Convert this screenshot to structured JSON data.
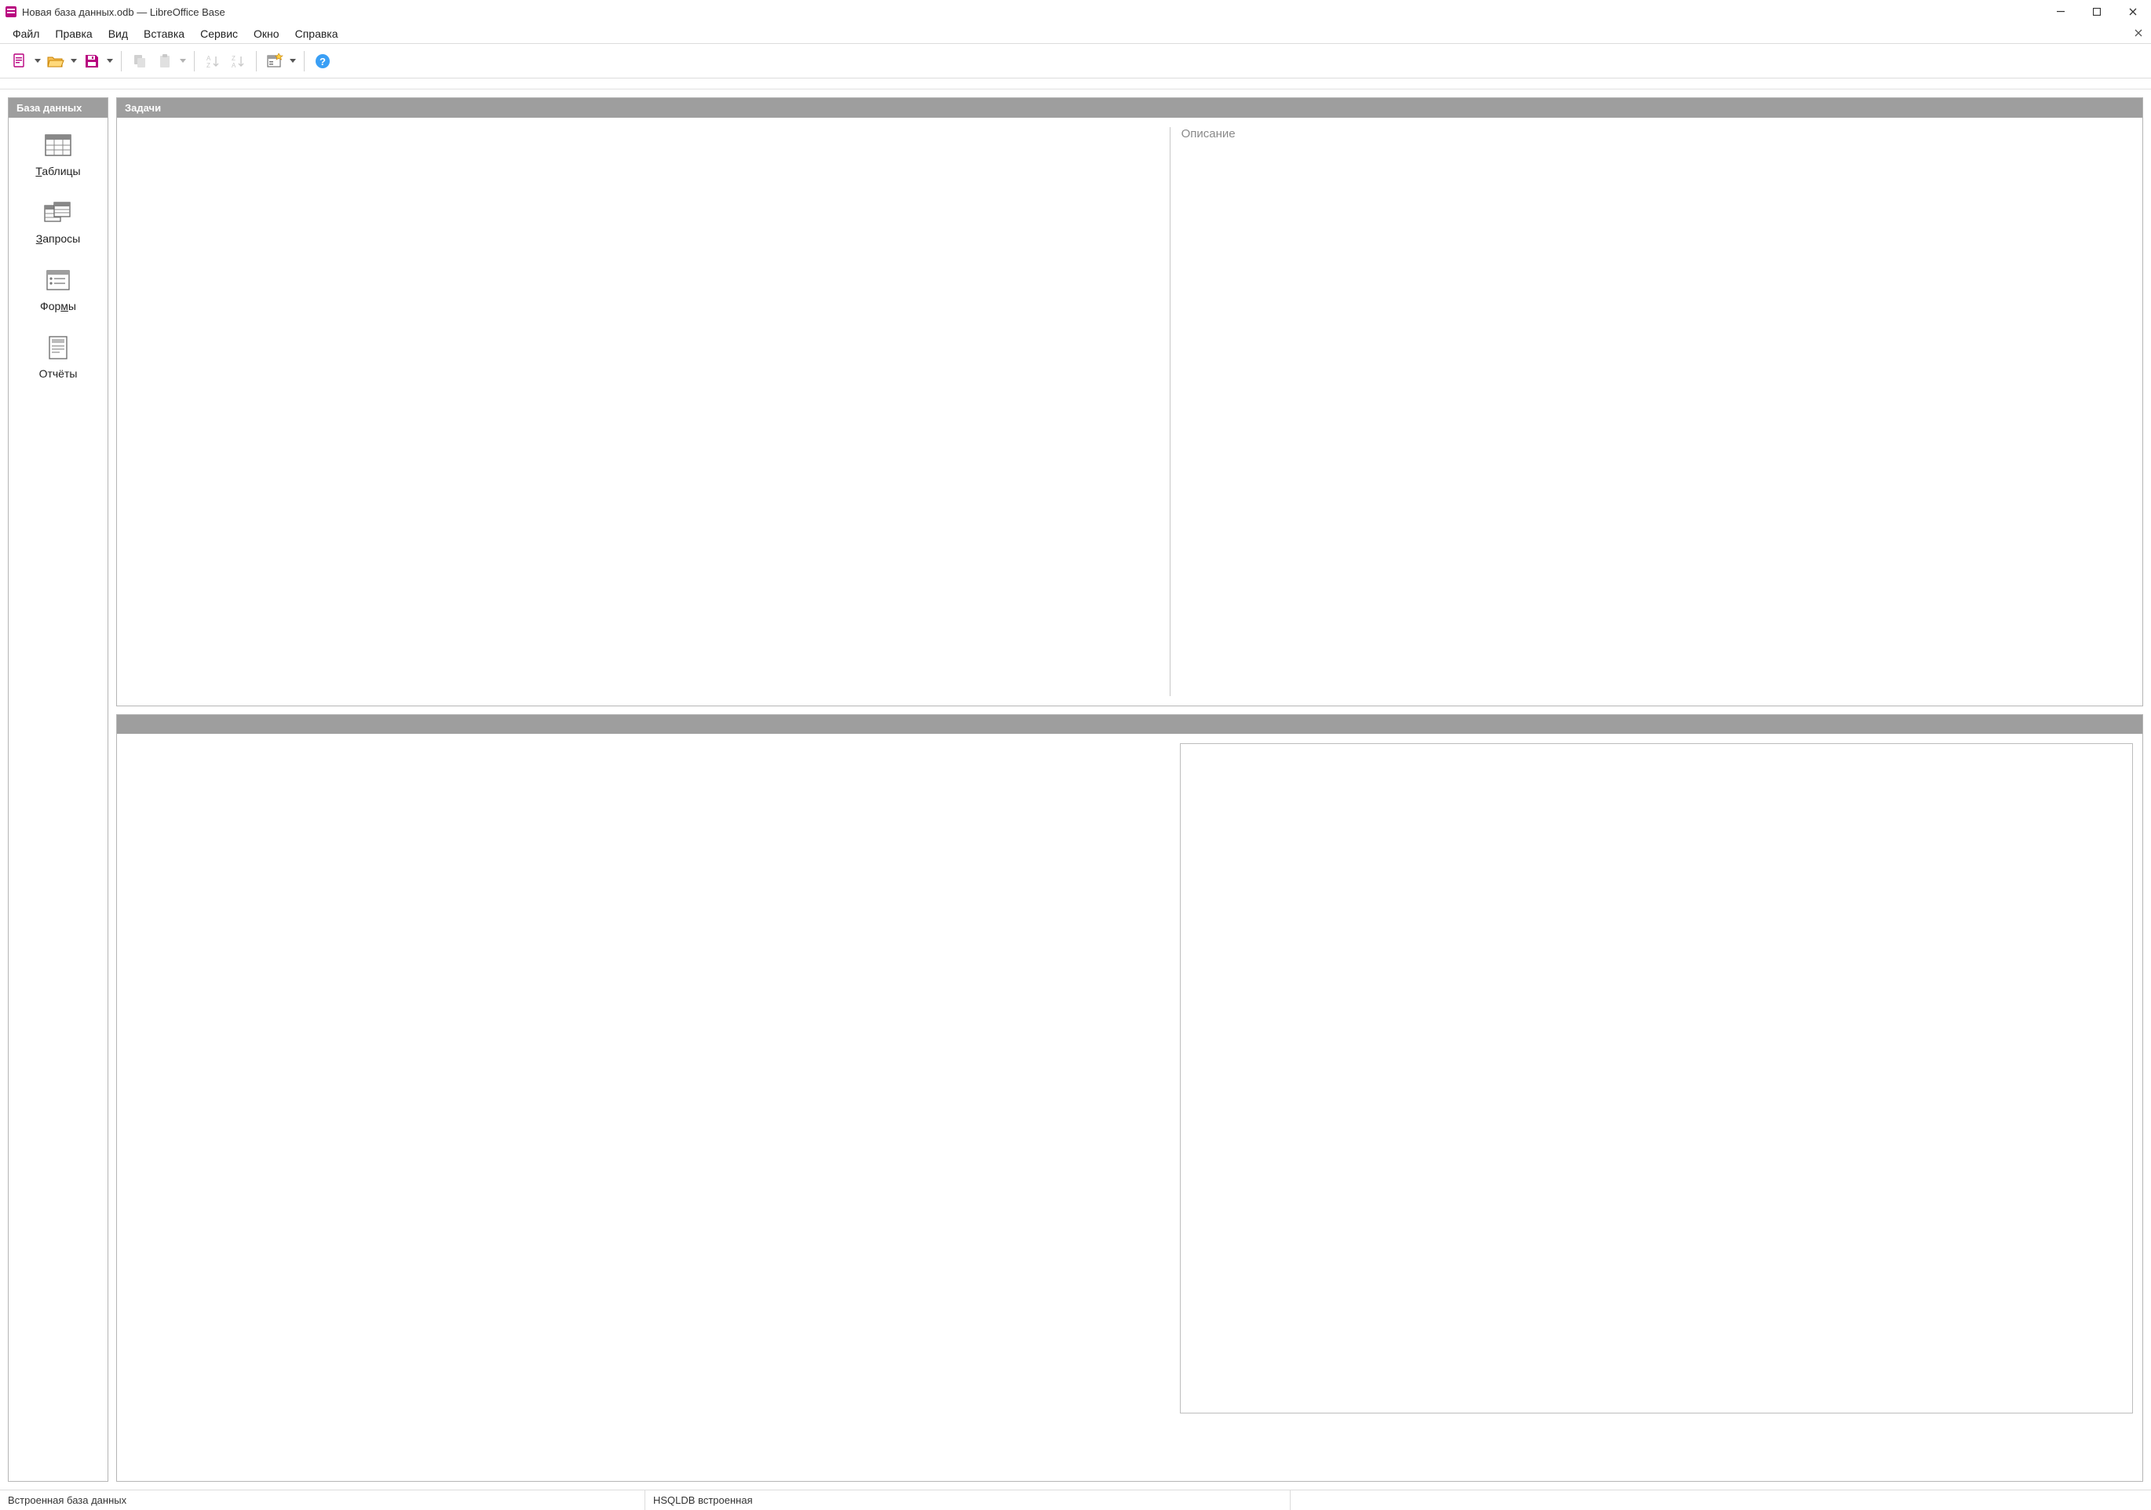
{
  "window": {
    "title": "Новая база данных.odb — LibreOffice Base"
  },
  "menu": {
    "file": "Файл",
    "edit": "Правка",
    "view": "Вид",
    "insert": "Вставка",
    "tools": "Сервис",
    "window": "Окно",
    "help": "Справка"
  },
  "sidebar": {
    "header": "База данных",
    "items": {
      "tables_pre": "Т",
      "tables_post": "аблицы",
      "queries_pre": "З",
      "queries_post": "апросы",
      "forms_pre": "Фор",
      "forms_mid": "м",
      "forms_post": "ы",
      "reports": "Отчёты"
    }
  },
  "tasks": {
    "header": "Задачи",
    "description_label": "Описание"
  },
  "objects": {
    "header": ""
  },
  "statusbar": {
    "left": "Встроенная база данных",
    "mid": "HSQLDB встроенная"
  },
  "colors": {
    "accent": "#b8007f",
    "folder": "#f5a623",
    "help": "#3a9ff5"
  }
}
